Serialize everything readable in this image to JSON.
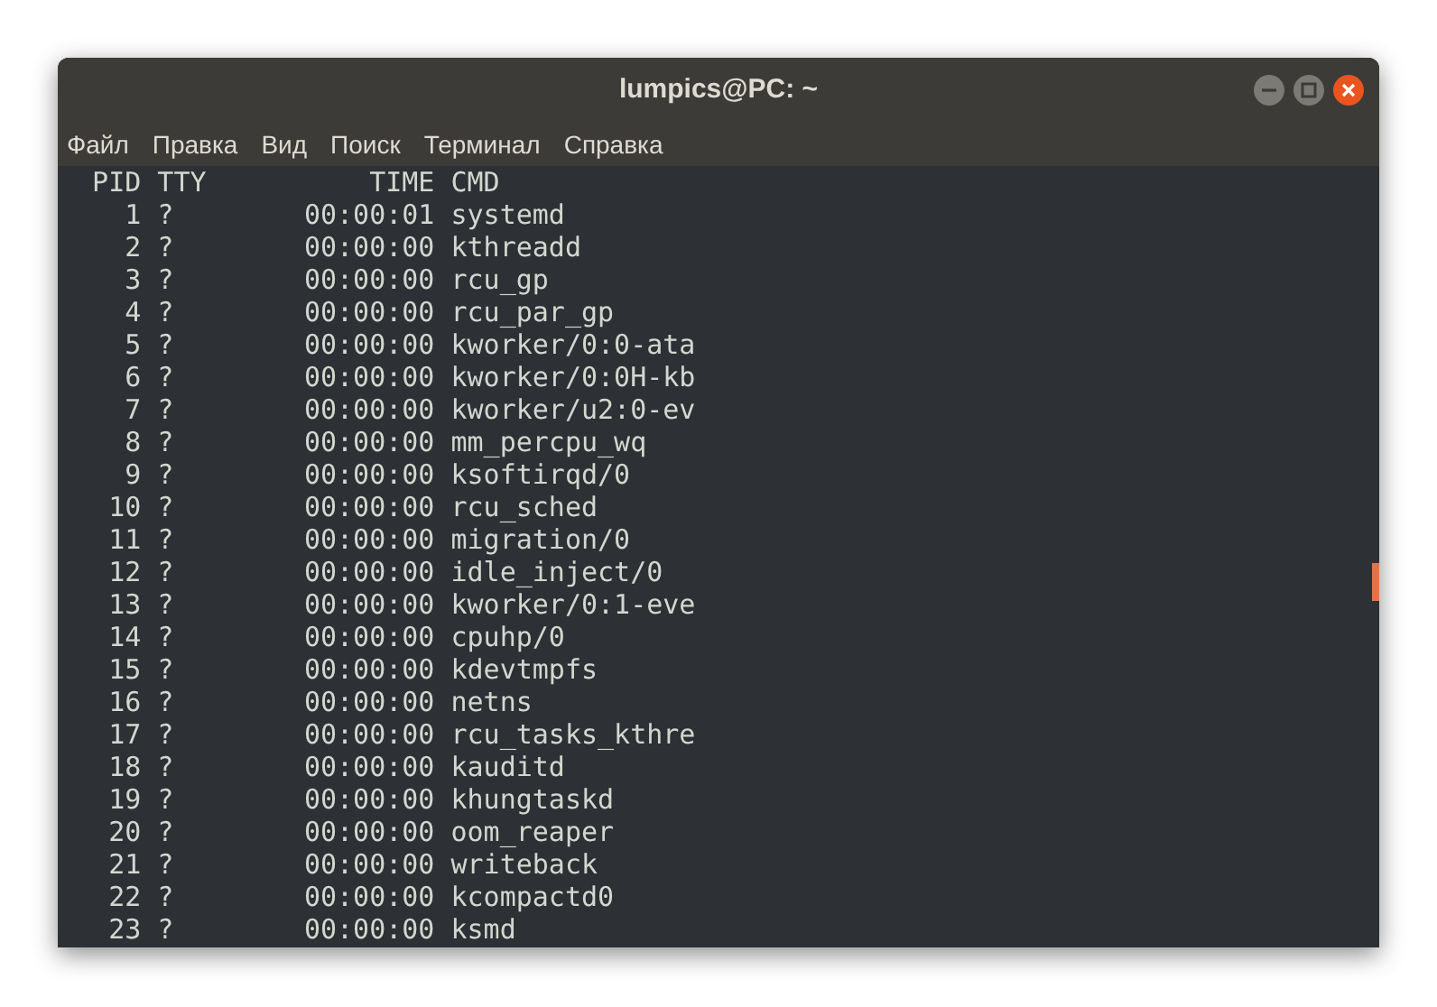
{
  "window": {
    "title": "lumpics@PC: ~"
  },
  "menu": [
    "Файл",
    "Правка",
    "Вид",
    "Поиск",
    "Терминал",
    "Справка"
  ],
  "terminal": {
    "header": {
      "pid": "PID",
      "tty": "TTY",
      "time": "TIME",
      "cmd": "CMD"
    },
    "rows": [
      {
        "pid": "1",
        "tty": "?",
        "time": "00:00:01",
        "cmd": "systemd"
      },
      {
        "pid": "2",
        "tty": "?",
        "time": "00:00:00",
        "cmd": "kthreadd"
      },
      {
        "pid": "3",
        "tty": "?",
        "time": "00:00:00",
        "cmd": "rcu_gp"
      },
      {
        "pid": "4",
        "tty": "?",
        "time": "00:00:00",
        "cmd": "rcu_par_gp"
      },
      {
        "pid": "5",
        "tty": "?",
        "time": "00:00:00",
        "cmd": "kworker/0:0-ata"
      },
      {
        "pid": "6",
        "tty": "?",
        "time": "00:00:00",
        "cmd": "kworker/0:0H-kb"
      },
      {
        "pid": "7",
        "tty": "?",
        "time": "00:00:00",
        "cmd": "kworker/u2:0-ev"
      },
      {
        "pid": "8",
        "tty": "?",
        "time": "00:00:00",
        "cmd": "mm_percpu_wq"
      },
      {
        "pid": "9",
        "tty": "?",
        "time": "00:00:00",
        "cmd": "ksoftirqd/0"
      },
      {
        "pid": "10",
        "tty": "?",
        "time": "00:00:00",
        "cmd": "rcu_sched"
      },
      {
        "pid": "11",
        "tty": "?",
        "time": "00:00:00",
        "cmd": "migration/0"
      },
      {
        "pid": "12",
        "tty": "?",
        "time": "00:00:00",
        "cmd": "idle_inject/0"
      },
      {
        "pid": "13",
        "tty": "?",
        "time": "00:00:00",
        "cmd": "kworker/0:1-eve"
      },
      {
        "pid": "14",
        "tty": "?",
        "time": "00:00:00",
        "cmd": "cpuhp/0"
      },
      {
        "pid": "15",
        "tty": "?",
        "time": "00:00:00",
        "cmd": "kdevtmpfs"
      },
      {
        "pid": "16",
        "tty": "?",
        "time": "00:00:00",
        "cmd": "netns"
      },
      {
        "pid": "17",
        "tty": "?",
        "time": "00:00:00",
        "cmd": "rcu_tasks_kthre"
      },
      {
        "pid": "18",
        "tty": "?",
        "time": "00:00:00",
        "cmd": "kauditd"
      },
      {
        "pid": "19",
        "tty": "?",
        "time": "00:00:00",
        "cmd": "khungtaskd"
      },
      {
        "pid": "20",
        "tty": "?",
        "time": "00:00:00",
        "cmd": "oom_reaper"
      },
      {
        "pid": "21",
        "tty": "?",
        "time": "00:00:00",
        "cmd": "writeback"
      },
      {
        "pid": "22",
        "tty": "?",
        "time": "00:00:00",
        "cmd": "kcompactd0"
      },
      {
        "pid": "23",
        "tty": "?",
        "time": "00:00:00",
        "cmd": "ksmd"
      }
    ]
  }
}
